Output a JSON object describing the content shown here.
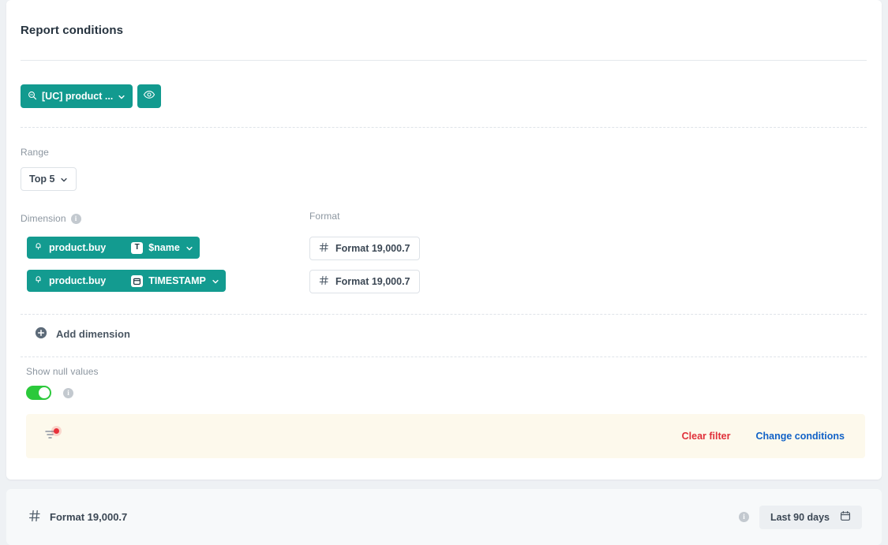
{
  "card": {
    "title": "Report conditions"
  },
  "source": {
    "chip_label": "[UC] product ...",
    "chip_icon": "search-zoom-icon",
    "preview_icon": "eye-icon",
    "chevron_icon": "chevron-down-icon"
  },
  "range": {
    "label": "Range",
    "value": "Top 5",
    "chevron_icon": "chevron-down-icon"
  },
  "dimension": {
    "label": "Dimension",
    "info_icon": "info-icon",
    "rows": [
      {
        "event_icon": "event-bell-icon",
        "source": "product.buy",
        "type_badge": "text-type-icon",
        "type_letter": "T",
        "property": "$name",
        "chevron_icon": "chevron-down-icon"
      },
      {
        "event_icon": "event-bell-icon",
        "source": "product.buy",
        "type_badge": "calendar-type-icon",
        "type_letter": "",
        "property": "TIMESTAMP",
        "chevron_icon": "chevron-down-icon"
      }
    ]
  },
  "format": {
    "label": "Format",
    "buttons": [
      {
        "icon": "hash-icon",
        "label": "Format 19,000.7"
      },
      {
        "icon": "hash-icon",
        "label": "Format 19,000.7"
      }
    ]
  },
  "add_dimension": {
    "icon": "plus-circle-icon",
    "label": "Add dimension"
  },
  "show_null": {
    "label": "Show null values",
    "toggle_on": true,
    "info_icon": "info-icon"
  },
  "banner": {
    "icon": "filter-sliders-icon",
    "badge": "red-dot-badge",
    "clear_label": "Clear filter",
    "change_label": "Change conditions"
  },
  "bottom_bar": {
    "metric_icon": "hash-icon",
    "metric_label": "Format 19,000.7",
    "info_icon": "info-icon",
    "date_label": "Last 90 days",
    "calendar_icon": "calendar-icon"
  },
  "colors": {
    "teal": "#129a8f",
    "toggle_green": "#2bc93b",
    "danger": "#e02f39",
    "link": "#1162c7",
    "banner_bg": "#fdf9ec",
    "page_bg": "#eef1f4"
  }
}
